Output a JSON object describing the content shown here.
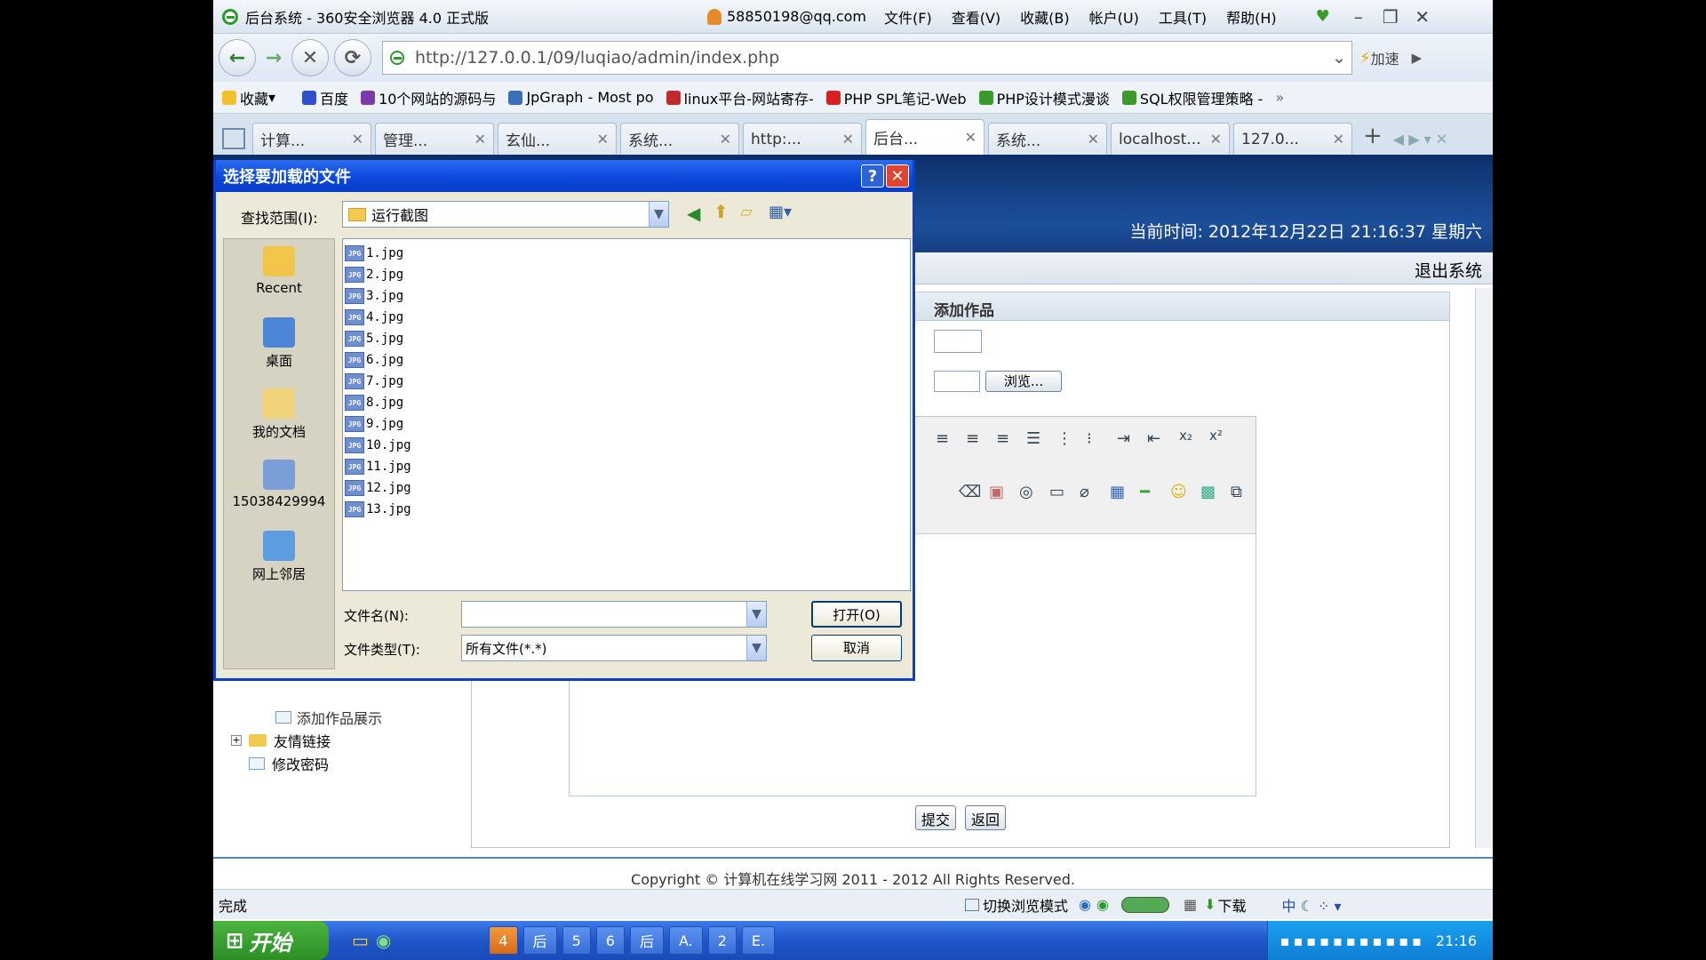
{
  "browser": {
    "window_title": "后台系统 - 360安全浏览器 4.0 正式版",
    "account": "58850198@qq.com",
    "menu": [
      "文件(F)",
      "查看(V)",
      "收藏(B)",
      "帐户(U)",
      "工具(T)",
      "帮助(H)"
    ],
    "url": "http://127.0.0.1/09/luqiao/admin/index.php",
    "speed_label": "加速",
    "bookmarks": [
      "收藏",
      "百度",
      "10个网站的源码与",
      "JpGraph - Most po",
      "linux平台-网站寄存-",
      "PHP SPL笔记-Web",
      "PHP设计模式漫谈",
      "SQL权限管理策略 -"
    ],
    "tabs": [
      "计算...",
      "管理...",
      "玄仙...",
      "系统...",
      "http:...",
      "后台...",
      "系统...",
      "localhost...",
      "127.0..."
    ]
  },
  "page": {
    "current_time": "当前时间: 2012年12月22日 21:16:37 星期六",
    "logout": "退出系统",
    "section_title": "添加作品",
    "browse_button": "浏览...",
    "submit_button": "提交",
    "back_button": "返回",
    "tree": [
      "添加作品展示",
      "友情链接",
      "修改密码"
    ],
    "footer": "Copyright © 计算机在线学习网 2011 - 2012 All Rights Reserved."
  },
  "status": {
    "left": "完成",
    "switch_mode": "切换浏览模式",
    "download": "下载"
  },
  "taskbar": {
    "start": "开始",
    "items": [
      "4",
      "后",
      "5",
      "6",
      "后",
      "A.",
      "2",
      "E."
    ],
    "clock": "21:16"
  },
  "dialog": {
    "title": "选择要加载的文件",
    "lookin_label": "查找范围(I):",
    "lookin_value": "运行截图",
    "places": [
      "Recent",
      "桌面",
      "我的文档",
      "15038429994",
      "网上邻居"
    ],
    "files": [
      "1.jpg",
      "2.jpg",
      "3.jpg",
      "4.jpg",
      "5.jpg",
      "6.jpg",
      "7.jpg",
      "8.jpg",
      "9.jpg",
      "10.jpg",
      "11.jpg",
      "12.jpg",
      "13.jpg"
    ],
    "filename_label": "文件名(N):",
    "filename_value": "",
    "filetype_label": "文件类型(T):",
    "filetype_value": "所有文件(*.*)",
    "open_button": "打开(O)",
    "cancel_button": "取消"
  }
}
